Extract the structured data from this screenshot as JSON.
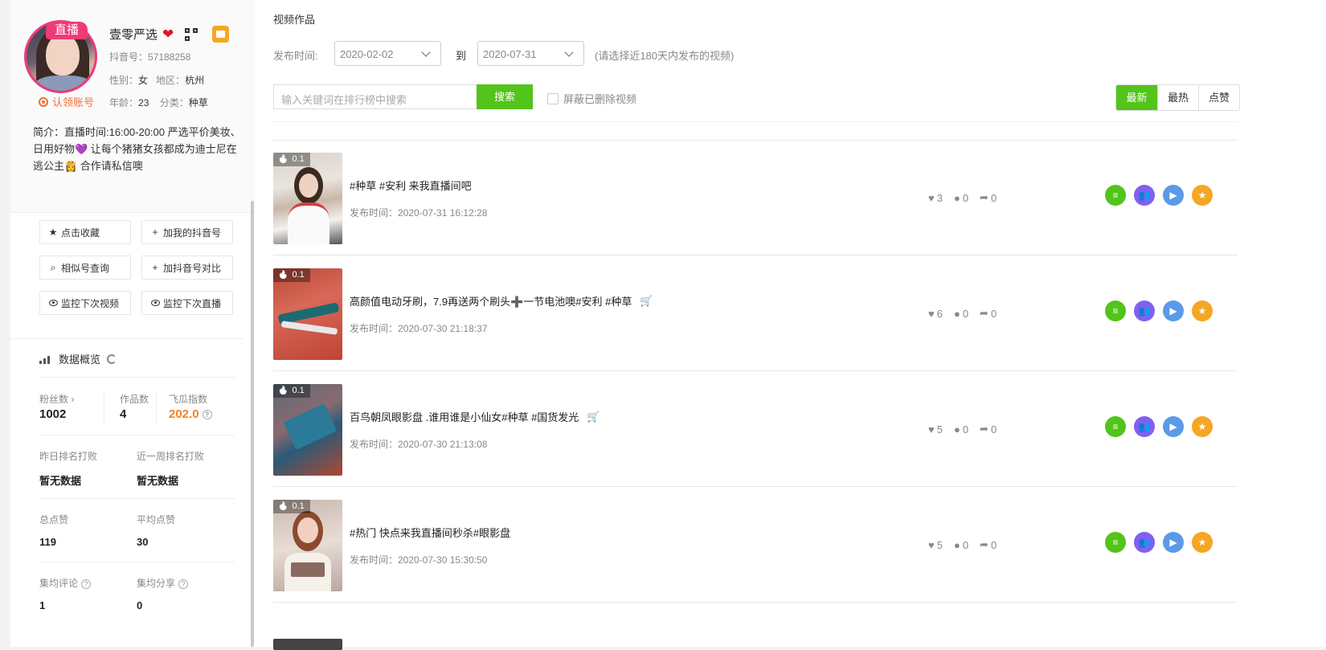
{
  "profile": {
    "live_badge": "直播",
    "name": "壹零严选",
    "heart": "❤",
    "douyin_id": "抖音号：57188258",
    "gender_label": "性别：",
    "gender": "女",
    "region_label": "地区：",
    "region": "杭州",
    "age_label": "年龄：",
    "age": "23",
    "category_label": "分类：",
    "category": "种草",
    "claim": "认领账号",
    "bio": "简介：直播时间:16:00-20:00 严选平价美妆、日用好物💜 让每个猪猪女孩都成为迪士尼在逃公主👸 合作请私信噢"
  },
  "actions": {
    "favorite": "点击收藏",
    "add_account": "加我的抖音号",
    "similar": "相似号查询",
    "compare": "加抖音号对比",
    "monitor_video": "监控下次视频",
    "monitor_live": "监控下次直播"
  },
  "overview": {
    "title": "数据概览",
    "fans_label": "粉丝数 ›",
    "fans": "1002",
    "works_label": "作品数",
    "works": "4",
    "index_label": "飞瓜指数",
    "index": "202.0",
    "rank_yesterday_label": "昨日排名打败",
    "rank_yesterday": "暂无数据",
    "rank_week_label": "近一周排名打败",
    "rank_week": "暂无数据",
    "total_likes_label": "总点赞",
    "total_likes": "119",
    "avg_likes_label": "平均点赞",
    "avg_likes": "30",
    "avg_comments_label": "集均评论",
    "avg_comments": "1",
    "avg_shares_label": "集均分享",
    "avg_shares": "0"
  },
  "main": {
    "title": "视频作品",
    "time_label": "发布时间:",
    "date_from": "2020-02-02",
    "to_label": "到",
    "date_to": "2020-07-31",
    "hint": "(请选择近180天内发布的视频)",
    "search_placeholder": "输入关键词在排行榜中搜索",
    "search_button": "搜索",
    "hide_deleted": "屏蔽已删除视频",
    "sort": [
      "最新",
      "最热",
      "点赞"
    ]
  },
  "videos": [
    {
      "hot": "0.1",
      "title": "#种草 #安利 来我直播间吧",
      "time": "发布时间：2020-07-31 16:12:28",
      "likes": "3",
      "comments": "0",
      "shares": "0"
    },
    {
      "hot": "0.1",
      "title": "高颜值电动牙刷，7.9再送两个刷头➕一节电池噢#安利 #种草",
      "time": "发布时间：2020-07-30 21:18:37",
      "likes": "6",
      "comments": "0",
      "shares": "0"
    },
    {
      "hot": "0.1",
      "title": "百鸟朝凤眼影盘 .谁用谁是小仙女#种草 #国货发光",
      "time": "发布时间：2020-07-30 21:13:08",
      "likes": "5",
      "comments": "0",
      "shares": "0"
    },
    {
      "hot": "0.1",
      "title": "#热门 快点来我直播间秒杀#眼影盘",
      "time": "发布时间：2020-07-30 15:30:50",
      "likes": "5",
      "comments": "0",
      "shares": "0"
    }
  ]
}
